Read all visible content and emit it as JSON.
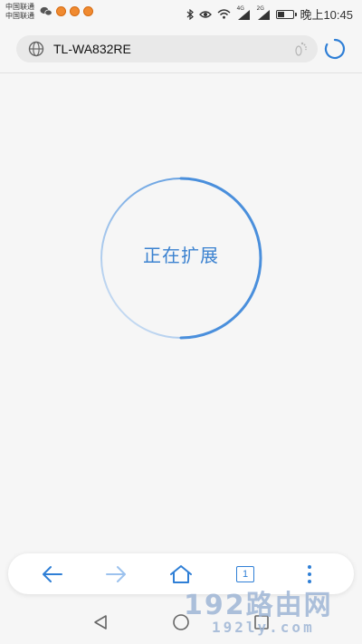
{
  "status_bar": {
    "carrier_line1": "中国联通",
    "carrier_line2": "中国联通",
    "network_badge_1": "4G",
    "network_badge_2": "2G",
    "time": "晚上10:45",
    "battery_level": 0.45
  },
  "address_bar": {
    "url": "TL-WA832RE",
    "site_icon": "globe-icon",
    "extra_icon": "footprint-icon",
    "reload_icon": "loading-spinner-icon"
  },
  "progress": {
    "label": "正在扩展",
    "accent_color": "#3b82d0"
  },
  "toolbar": {
    "back_icon": "arrow-left-icon",
    "forward_icon": "arrow-right-icon",
    "home_icon": "home-icon",
    "tab_count": "1",
    "menu_icon": "more-vertical-icon"
  },
  "nav_bar": {
    "back_icon": "triangle-back-icon",
    "home_icon": "circle-home-icon",
    "recents_icon": "square-recents-icon"
  },
  "watermark": {
    "brand": "192路由网",
    "domain": "192ly.com"
  }
}
